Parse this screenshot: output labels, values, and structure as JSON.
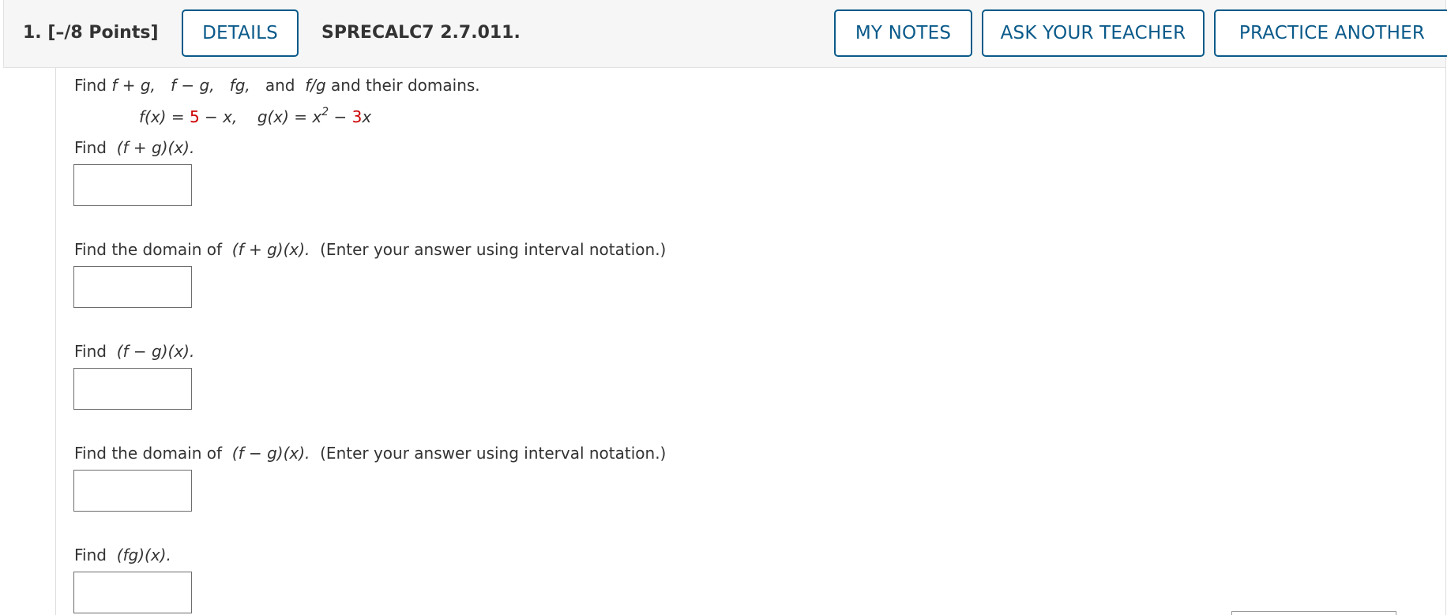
{
  "header": {
    "question_number": "1.",
    "points": "[–/8 Points]",
    "details_label": "DETAILS",
    "problem_code": "SPRECALC7 2.7.011.",
    "my_notes_label": "MY NOTES",
    "ask_teacher_label": "ASK YOUR TEACHER",
    "practice_label": "PRACTICE ANOTHER"
  },
  "problem": {
    "intro_prefix": "Find ",
    "intro_ops": [
      "f + g,",
      "f − g,",
      "fg,"
    ],
    "intro_and": "and",
    "intro_last_op": "f/g",
    "intro_suffix": " and their domains.",
    "f_lhs": "f(x) = ",
    "f_const": "5",
    "f_rest": " − x,",
    "g_lhs": "g(x) = x",
    "g_exp": "2",
    "g_minus": " − ",
    "g_coef": "3",
    "g_var": "x"
  },
  "parts": [
    {
      "prefix": "Find ",
      "expr": "(f + g)(x).",
      "note": ""
    },
    {
      "prefix": "Find the domain of ",
      "expr": "(f + g)(x).",
      "note": "(Enter your answer using interval notation.)"
    },
    {
      "prefix": "Find ",
      "expr": "(f − g)(x).",
      "note": ""
    },
    {
      "prefix": "Find the domain of ",
      "expr": "(f − g)(x).",
      "note": "(Enter your answer using interval notation.)"
    },
    {
      "prefix": "Find ",
      "expr": "(fg)(x).",
      "note": ""
    }
  ],
  "colors": {
    "accent": "#0a5a8a",
    "highlight": "#cc0000",
    "header_bg": "#f6f6f6"
  }
}
